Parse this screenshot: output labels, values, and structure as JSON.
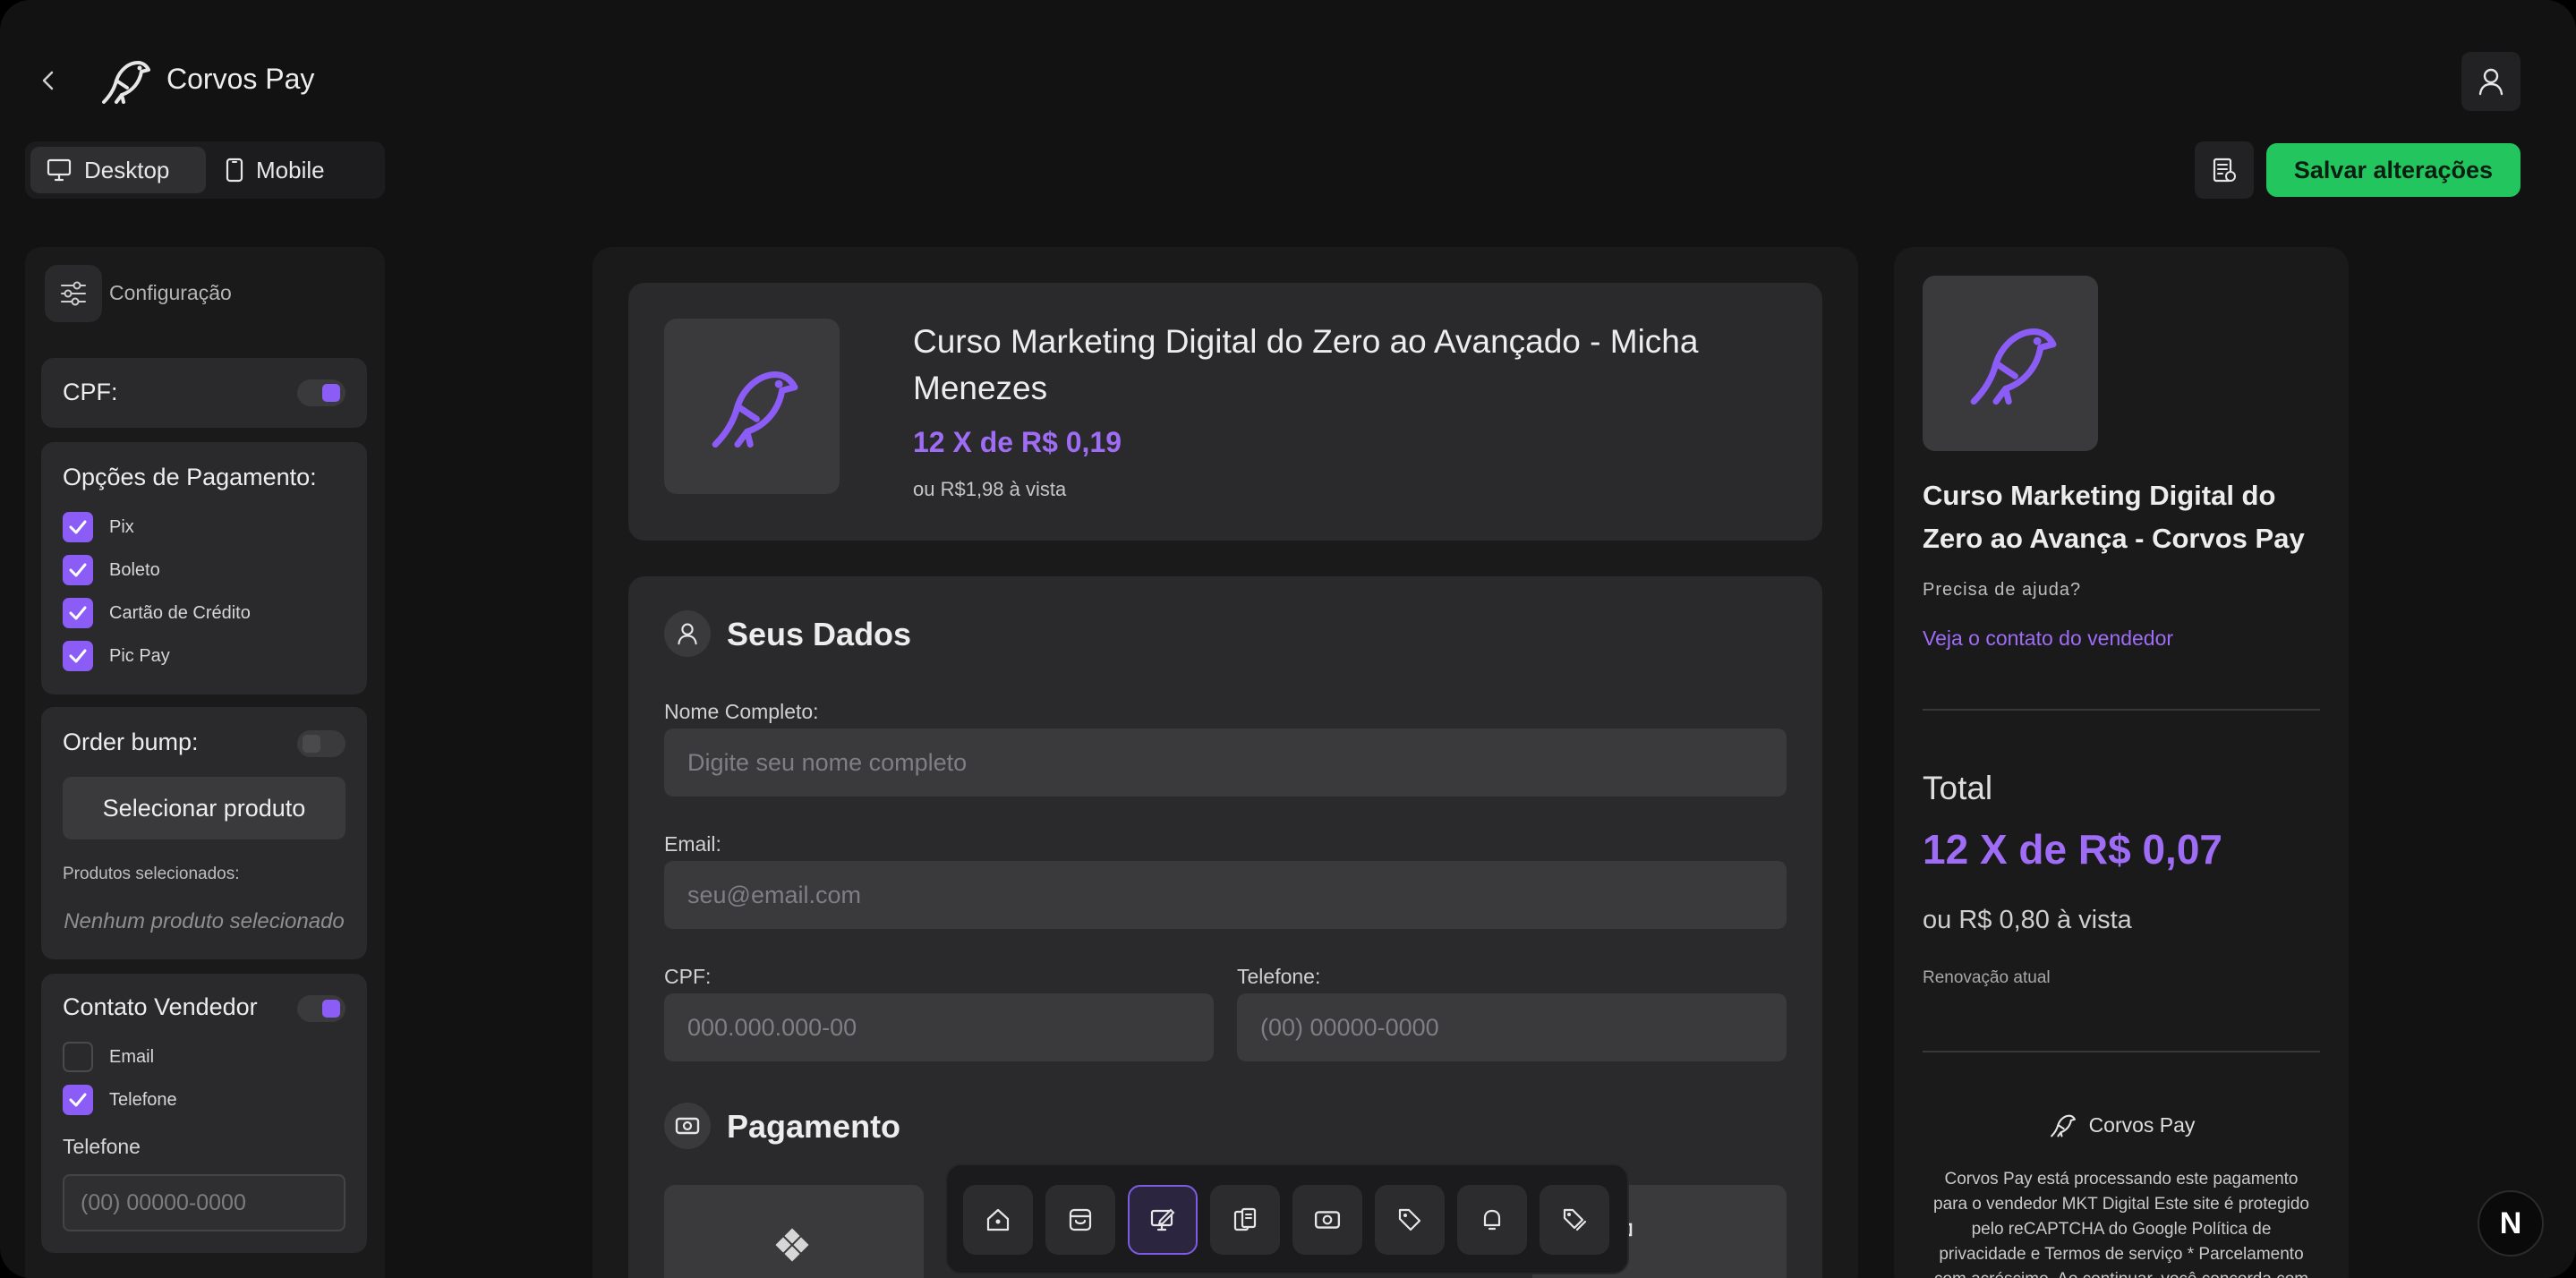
{
  "header": {
    "brand_name": "Corvos Pay",
    "device_tabs": [
      {
        "label": "Desktop",
        "active": true
      },
      {
        "label": "Mobile",
        "active": false
      }
    ],
    "save_label": "Salvar alterações"
  },
  "sidebar": {
    "config_label": "Configuração",
    "cpf": {
      "label": "CPF:",
      "enabled": true
    },
    "payment_options": {
      "title": "Opções de Pagamento:",
      "items": [
        {
          "label": "Pix",
          "checked": true
        },
        {
          "label": "Boleto",
          "checked": true
        },
        {
          "label": "Cartão de Crédito",
          "checked": true
        },
        {
          "label": "Pic Pay",
          "checked": true
        }
      ]
    },
    "order_bump": {
      "title": "Order bump:",
      "enabled": false,
      "select_label": "Selecionar produto",
      "selected_label": "Produtos selecionados:",
      "empty_label": "Nenhum produto selecionado"
    },
    "seller_contact": {
      "title": "Contato Vendedor",
      "enabled": true,
      "options": [
        {
          "label": "Email",
          "checked": false
        },
        {
          "label": "Telefone",
          "checked": true
        }
      ],
      "phone_label": "Telefone",
      "phone_placeholder": "(00) 00000-0000"
    }
  },
  "product": {
    "title": "Curso Marketing Digital do Zero ao Avançado - Micha Menezes",
    "price": "12 X de R$ 0,19",
    "cash_price": "ou R$1,98 à vista"
  },
  "form": {
    "section_title": "Seus Dados",
    "name": {
      "label": "Nome Completo:",
      "placeholder": "Digite seu nome completo"
    },
    "email": {
      "label": "Email:",
      "placeholder": "seu@email.com"
    },
    "cpf": {
      "label": "CPF:",
      "placeholder": "000.000.000-00"
    },
    "phone": {
      "label": "Telefone:",
      "placeholder": "(00) 00000-0000"
    },
    "payment_title": "Pagamento"
  },
  "dock": {
    "icons": [
      "home-icon",
      "store-icon",
      "edit-screen-icon",
      "devices-icon",
      "money-icon",
      "tag-icon",
      "bell-icon",
      "discount-icon"
    ],
    "active_index": 2
  },
  "summary": {
    "title": "Curso Marketing Digital do Zero ao Avança - Corvos Pay",
    "help_label": "Precisa de ajuda?",
    "contact_link": "Veja o contato do vendedor",
    "total_label": "Total",
    "total_price": "12 X de R$ 0,07",
    "cash_price": "ou R$ 0,80 à vista",
    "renewal_label": "Renovação atual",
    "brand_name": "Corvos Pay",
    "legal_text": "Corvos Pay está processando este pagamento para o vendedor MKT Digital Este site é protegido pelo reCAPTCHA do Google Política de privacidade e Termos de serviço * Parcelamento com acréscimo. Ao continuar, você concorda com os"
  },
  "colors": {
    "accent": "#8b5cf6",
    "save": "#22c55e",
    "background": "#121213"
  }
}
